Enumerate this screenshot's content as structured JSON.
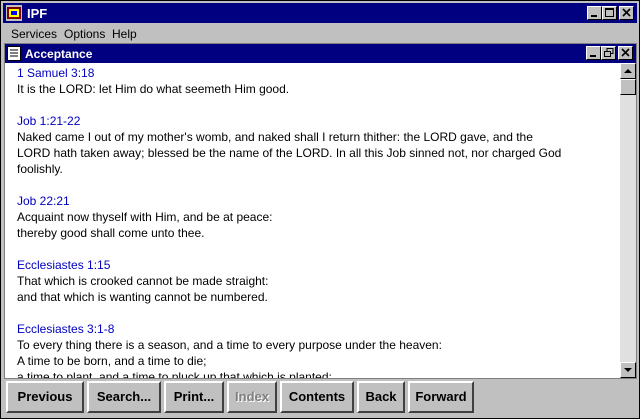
{
  "app": {
    "title": "IPF"
  },
  "menubar": [
    {
      "label": "Services"
    },
    {
      "label": "Options"
    },
    {
      "label": "Help"
    }
  ],
  "document": {
    "title": "Acceptance",
    "entries": [
      {
        "ref": "1 Samuel 3:18",
        "text": "It is the LORD: let Him do what seemeth Him good."
      },
      {
        "ref": "Job 1:21-22",
        "text": "Naked came I out of my mother's womb, and naked shall I return thither: the LORD gave, and the\nLORD hath taken away; blessed be the name of the LORD. In all this Job sinned not, nor charged God\nfoolishly."
      },
      {
        "ref": "Job 22:21",
        "text": "Acquaint now thyself with Him, and be at peace:\nthereby good shall come unto thee."
      },
      {
        "ref": "Ecclesiastes 1:15",
        "text": "That which is crooked cannot be made straight:\nand that which is wanting cannot be numbered."
      },
      {
        "ref": "Ecclesiastes 3:1-8",
        "text": "To every thing there is a season, and a time to every purpose under the heaven:\nA time to be born, and a time to die;\na time to plant, and a time to pluck up that which is planted;"
      }
    ]
  },
  "buttons": {
    "previous": "Previous",
    "search": "Search...",
    "print": "Print...",
    "index": "Index",
    "contents": "Contents",
    "back": "Back",
    "forward": "Forward"
  }
}
